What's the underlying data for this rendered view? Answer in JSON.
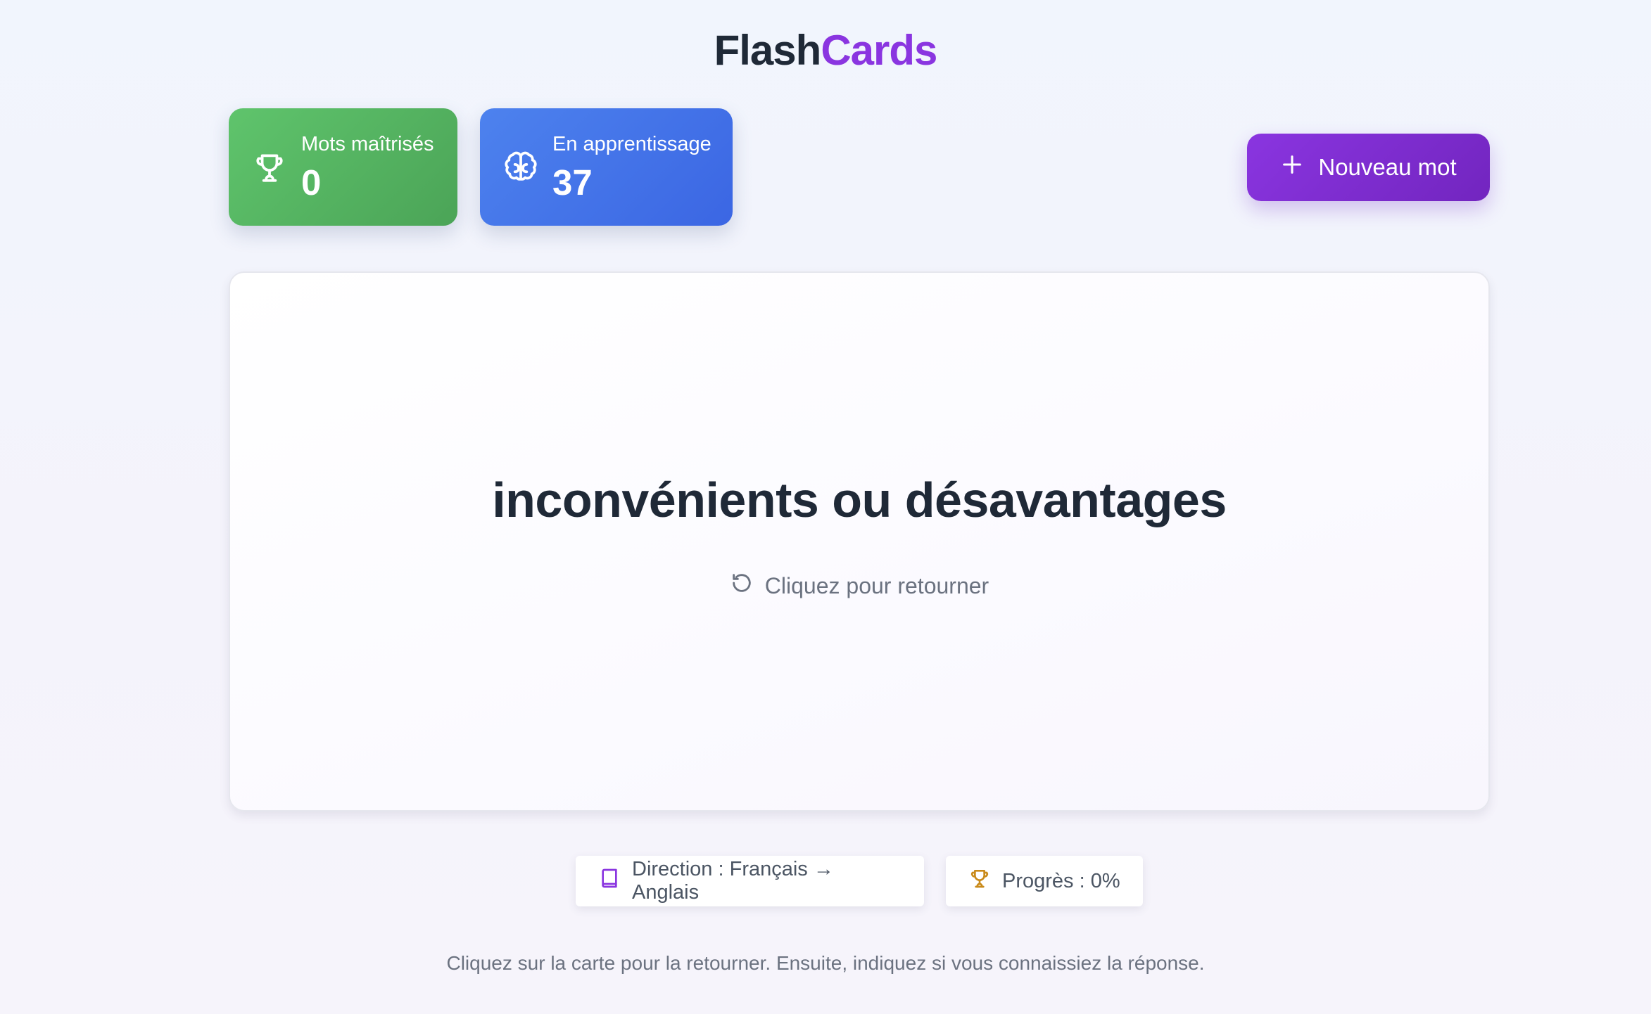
{
  "app": {
    "title_part1": "Flash",
    "title_part2": "Cards"
  },
  "stats": {
    "mastered": {
      "label": "Mots maîtrisés",
      "value": "0",
      "icon": "trophy-icon"
    },
    "learning": {
      "label": "En apprentissage",
      "value": "37",
      "icon": "brain-icon"
    }
  },
  "toolbar": {
    "new_word_label": "Nouveau mot",
    "new_word_icon": "plus-icon"
  },
  "card": {
    "word": "inconvénients ou désavantages",
    "flip_hint": "Cliquez pour retourner",
    "flip_icon": "rotate-icon"
  },
  "footer": {
    "direction": "Direction : Français → Anglais",
    "direction_icon": "book-icon",
    "progress": "Progrès : 0%",
    "progress_icon": "trophy-icon",
    "instructions": "Cliquez sur la carte pour la retourner. Ensuite, indiquez si vous connaissiez la réponse."
  },
  "colors": {
    "accent_purple": "#8a35e0",
    "mastered_green": "#5fc46c",
    "learning_blue": "#4d82ee",
    "progress_gold": "#c98a1a",
    "text_dark": "#1f2937",
    "text_muted": "#6b7280"
  }
}
